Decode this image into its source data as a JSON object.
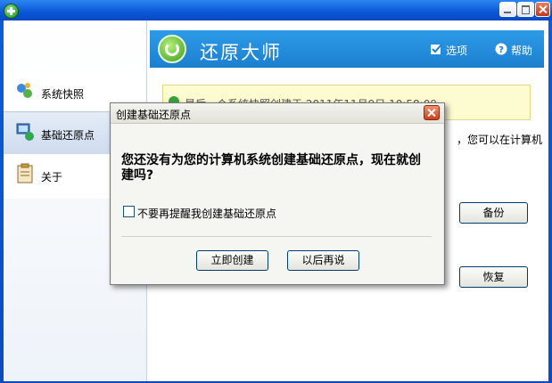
{
  "app": {
    "title": "还原大师",
    "options_label": "选项",
    "help_label": "帮助"
  },
  "sidebar": {
    "items": [
      {
        "label": "系统快照"
      },
      {
        "label": "基础还原点"
      },
      {
        "label": "关于"
      }
    ]
  },
  "main": {
    "info_text": "最后一个系统快照创建于 2011年11月9日 10:58:09",
    "hint_text": "，您可以在计算机",
    "backup_label": "备份",
    "restore_label": "恢复"
  },
  "dialog": {
    "title": "创建基础还原点",
    "message": "您还没有为您的计算机系统创建基础还原点，现在就创建吗?",
    "checkbox_label": "不要再提醒我创建基础还原点",
    "checkbox_checked": false,
    "create_now_label": "立即创建",
    "later_label": "以后再说"
  },
  "colors": {
    "header_blue": "#1c7fd0",
    "title_bar": "#0a56d8"
  }
}
